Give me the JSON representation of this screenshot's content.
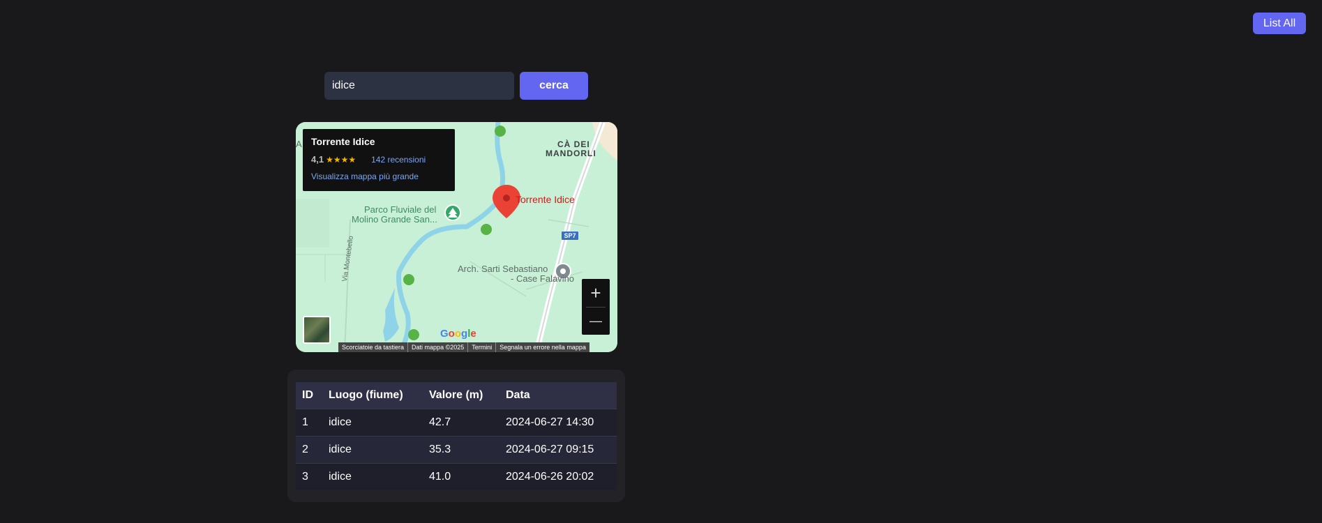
{
  "toolbar": {
    "list_all_label": "List All"
  },
  "search": {
    "value": "idice",
    "button_label": "cerca"
  },
  "map": {
    "info_card": {
      "title": "Torrente Idice",
      "rating": "4,1",
      "stars": "★★★★",
      "reviews": "142 recensioni",
      "bigger_map_link": "Visualizza mappa più grande"
    },
    "labels": {
      "pin": "Torrente Idice",
      "park_line1": "Parco Fluviale del",
      "park_line2": "Molino Grande San...",
      "area_line1": "CÀ DEI",
      "area_line2": "MANDORLI",
      "arch_line1": "Arch. Sarti Sebastiano",
      "arch_line2": "- Case Falavino",
      "road_montebello": "Via Montebello",
      "road_badge": "SP7",
      "edge_fragment": "A"
    },
    "zoom_in": "+",
    "zoom_out": "—",
    "google_logo": "Google",
    "attribution": [
      "Scorciatoie da tastiera",
      "Dati mappa ©2025",
      "Termini",
      "Segnala un errore nella mappa"
    ]
  },
  "table": {
    "headers": [
      "ID",
      "Luogo (fiume)",
      "Valore (m)",
      "Data"
    ],
    "rows": [
      [
        "1",
        "idice",
        "42.7",
        "2024-06-27 14:30"
      ],
      [
        "2",
        "idice",
        "35.3",
        "2024-06-27 09:15"
      ],
      [
        "3",
        "idice",
        "41.0",
        "2024-06-26 20:02"
      ]
    ]
  },
  "colors": {
    "accent": "#6366f1",
    "background": "#19191c",
    "map_green": "#c8f0d6",
    "river": "#8fd3e8"
  },
  "icons": {
    "pin": "map-pin-icon",
    "park": "tree-icon",
    "place": "place-marker-icon"
  }
}
